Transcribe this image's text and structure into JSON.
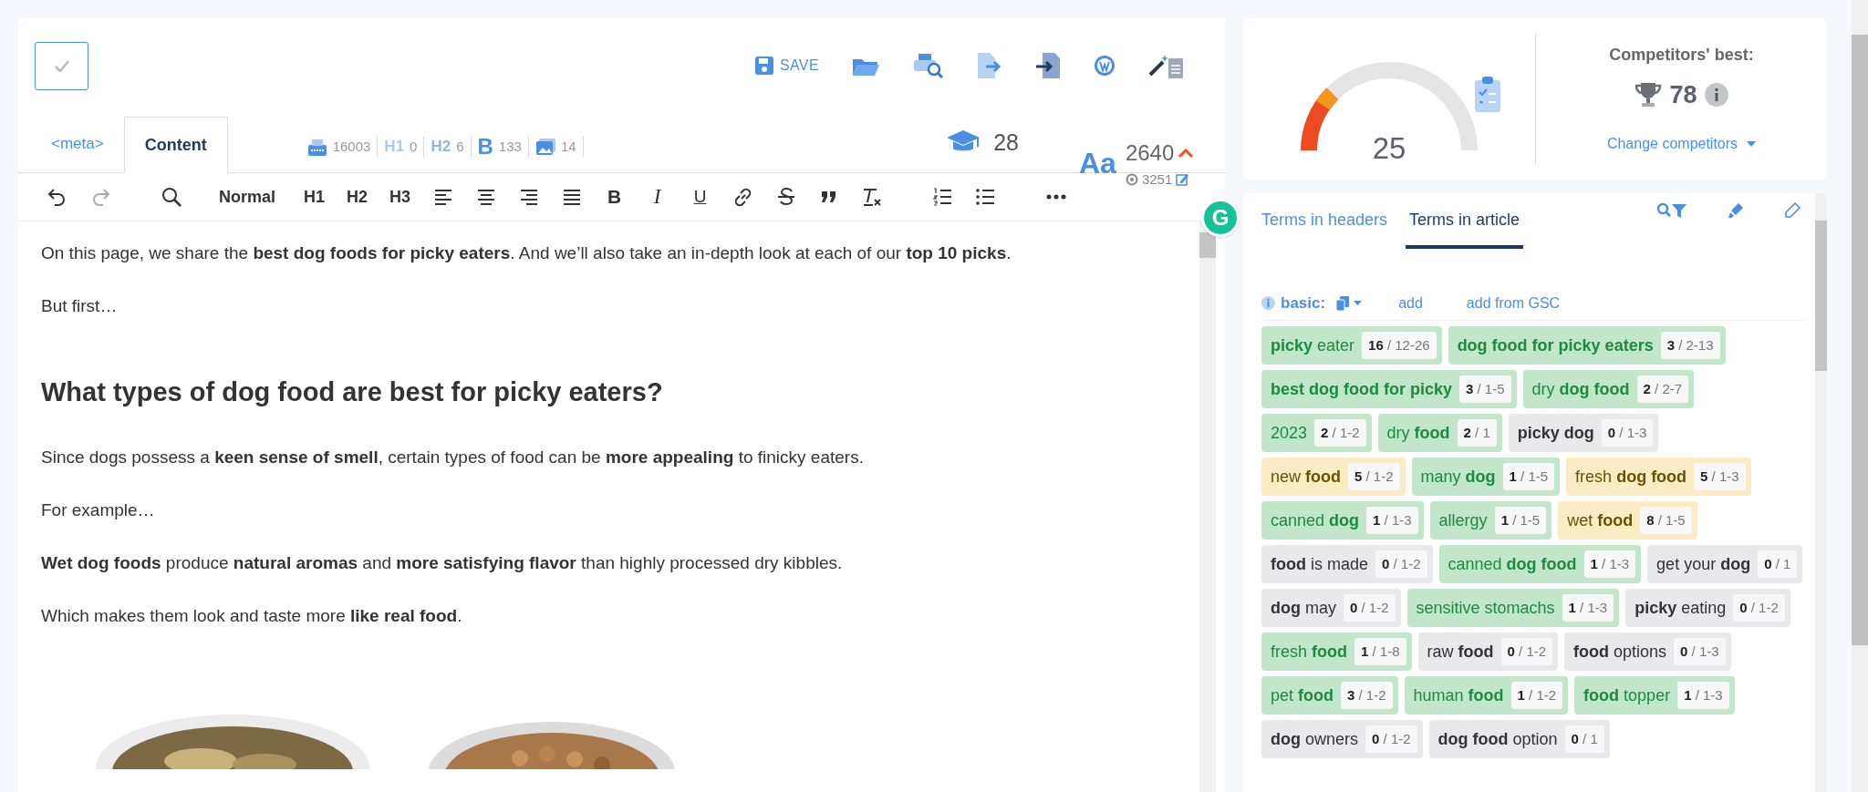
{
  "header": {
    "save_label": "SAVE"
  },
  "tabs": [
    {
      "label": "<meta>",
      "selected": false
    },
    {
      "label": "Content",
      "selected": true
    }
  ],
  "stats": [
    {
      "kind": "chars",
      "value": "16003"
    },
    {
      "kind": "h1",
      "label": "H1",
      "value": "0"
    },
    {
      "kind": "h2",
      "label": "H2",
      "value": "6"
    },
    {
      "kind": "bold",
      "label": "B",
      "value": "133"
    },
    {
      "kind": "images",
      "value": "14"
    }
  ],
  "readability": {
    "value": "28"
  },
  "words": {
    "label": "Aa",
    "value": "2640",
    "target": "3251"
  },
  "toolbar": [
    {
      "kind": "undo"
    },
    {
      "kind": "redo"
    },
    {
      "kind": "search"
    },
    {
      "kind": "text",
      "label": "Normal"
    },
    {
      "kind": "text",
      "label": "H1"
    },
    {
      "kind": "text",
      "label": "H2"
    },
    {
      "kind": "text",
      "label": "H3"
    },
    {
      "kind": "align-left"
    },
    {
      "kind": "align-center"
    },
    {
      "kind": "align-right"
    },
    {
      "kind": "justify"
    },
    {
      "kind": "bold",
      "label": "B"
    },
    {
      "kind": "italic",
      "label": "I"
    },
    {
      "kind": "underline",
      "label": "U"
    },
    {
      "kind": "link"
    },
    {
      "kind": "strike"
    },
    {
      "kind": "quote"
    },
    {
      "kind": "clear"
    },
    {
      "kind": "ordered"
    },
    {
      "kind": "bullets"
    },
    {
      "kind": "more"
    }
  ],
  "assistant_badge": "G",
  "content": [
    {
      "kind": "p",
      "text": "On this page, we share the **best dog foods for picky eaters**. And we’ll also take an in-depth look at each of our **top 10 picks**."
    },
    {
      "kind": "p",
      "text": "But first…"
    },
    {
      "kind": "h2",
      "text": "What types of dog food are best for picky eaters?"
    },
    {
      "kind": "p",
      "text": "Since dogs possess a **keen sense of smell**, certain types of food can be **more appealing** to finicky eaters."
    },
    {
      "kind": "p",
      "text": "For example…"
    },
    {
      "kind": "p",
      "text": "**Wet dog foods** produce **natural aromas** and **more satisfying flavor** than highly processed dry kibbles."
    },
    {
      "kind": "p",
      "text": "Which makes them look and taste more **like real food**."
    },
    {
      "kind": "picture"
    }
  ],
  "score": {
    "value": "25"
  },
  "competitors": {
    "title": "Competitors' best:",
    "value": "78",
    "link": "Change competitors"
  },
  "term_tabs": [
    {
      "label": "Terms in headers",
      "selected": false
    },
    {
      "label": "Terms in article",
      "selected": true
    }
  ],
  "term_group": {
    "label": "basic:",
    "actions": [
      "add",
      "add from GSC"
    ]
  },
  "terms": [
    {
      "text": "**picky** eater",
      "count": "**16** / 12-26",
      "color": "#c1e6ca"
    },
    {
      "text": "**dog food for picky eaters**",
      "count": "**3** / 2-13",
      "color": "#c1e6ca"
    },
    {
      "text": "**best dog food for picky**",
      "count": "**3** / 1-5",
      "color": "#c1e6ca"
    },
    {
      "text": "dry **dog food**",
      "count": "**2** / 2-7",
      "color": "#c1e6ca"
    },
    {
      "text": "2023",
      "count": "**2** / 1-2",
      "color": "#c1e6ca"
    },
    {
      "text": "dry **food**",
      "count": "**2** / 1",
      "color": "#c1e6ca"
    },
    {
      "text": "**picky dog**",
      "count": "**0** / 1-3",
      "color": "#e9e9eb"
    },
    {
      "text": "new **food**",
      "count": "**5** / 1-2",
      "color": "#fbecc4"
    },
    {
      "text": "many **dog**",
      "count": "**1** / 1-5",
      "color": "#c1e6ca"
    },
    {
      "text": "fresh **dog food**",
      "count": "**5** / 1-3",
      "color": "#fbecc4"
    },
    {
      "text": "canned **dog**",
      "count": "**1** / 1-3",
      "color": "#c1e6ca"
    },
    {
      "text": "allergy",
      "count": "**1** / 1-5",
      "color": "#c1e6ca"
    },
    {
      "text": "wet **food**",
      "count": "**8** / 1-5",
      "color": "#fbecc4"
    },
    {
      "text": "**food** is made",
      "count": "**0** / 1-2",
      "color": "#e9e9eb"
    },
    {
      "text": "canned **dog food**",
      "count": "**1** / 1-3",
      "color": "#c1e6ca"
    },
    {
      "text": "get your **dog**",
      "count": "**0** / 1",
      "color": "#e9e9eb"
    },
    {
      "text": "**dog** may",
      "count": "**0** / 1-2",
      "color": "#e9e9eb"
    },
    {
      "text": "sensitive stomachs",
      "count": "**1** / 1-3",
      "color": "#c1e6ca"
    },
    {
      "text": "**picky** eating",
      "count": "**0** / 1-2",
      "color": "#e9e9eb"
    },
    {
      "text": "fresh **food**",
      "count": "**1** / 1-8",
      "color": "#c1e6ca"
    },
    {
      "text": "raw **food**",
      "count": "**0** / 1-2",
      "color": "#e9e9eb"
    },
    {
      "text": "**food** options",
      "count": "**0** / 1-3",
      "color": "#e9e9eb"
    },
    {
      "text": "pet **food**",
      "count": "**3** / 1-2",
      "color": "#c1e6ca"
    },
    {
      "text": "human **food**",
      "count": "**1** / 1-2",
      "color": "#c1e6ca"
    },
    {
      "text": "**food** topper",
      "count": "**1** / 1-3",
      "color": "#c1e6ca"
    },
    {
      "text": "**dog** owners",
      "count": "**0** / 1-2",
      "color": "#e9e9eb"
    },
    {
      "text": "**dog food** option",
      "count": "**0** / 1",
      "color": "#e9e9eb"
    }
  ]
}
